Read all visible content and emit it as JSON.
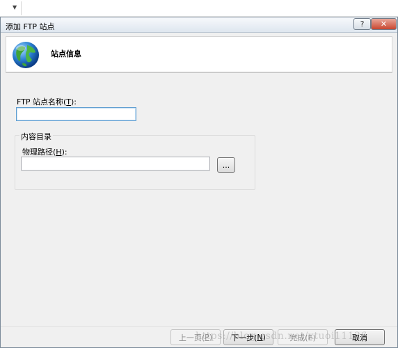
{
  "dialog": {
    "title": "添加 FTP 站点",
    "help_glyph": "?",
    "close_glyph": "✕"
  },
  "banner": {
    "heading": "站点信息",
    "icon": "globe-icon"
  },
  "site_name": {
    "label_prefix": "FTP 站点名称(",
    "accel": "T",
    "label_suffix": "):",
    "value": ""
  },
  "content_directory": {
    "group_title": "内容目录",
    "path_label_prefix": "物理路径(",
    "path_accel": "H",
    "path_label_suffix": "):",
    "path_value": "",
    "browse_label": "..."
  },
  "footer": {
    "prev_prefix": "上一页(",
    "prev_accel": "P",
    "prev_suffix": ")",
    "next_prefix": "下一步(",
    "next_accel": "N",
    "next_suffix": ")",
    "finish_label": "完成(E)",
    "cancel_label": "取消"
  },
  "watermark": "https://blog.csdn.net/xtuoi11126"
}
